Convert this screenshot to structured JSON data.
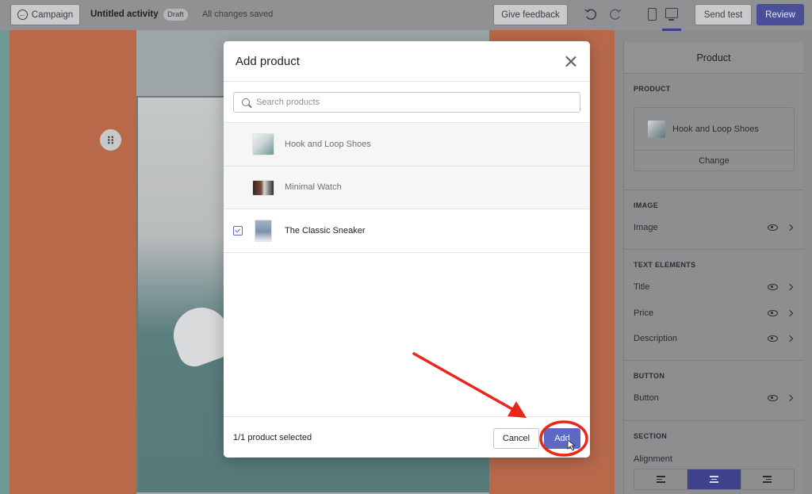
{
  "topbar": {
    "campaign_label": "Campaign",
    "activity_title": "Untitled activity",
    "status_badge": "Draft",
    "save_status": "All changes saved",
    "feedback_label": "Give feedback",
    "send_test_label": "Send test",
    "review_label": "Review"
  },
  "panel": {
    "title": "Product",
    "product_section": "PRODUCT",
    "selected_product": "Hook and Loop Shoes",
    "change_label": "Change",
    "image_section": "IMAGE",
    "image_row": "Image",
    "text_section": "TEXT ELEMENTS",
    "title_row": "Title",
    "price_row": "Price",
    "description_row": "Description",
    "button_section": "BUTTON",
    "button_row": "Button",
    "section_section": "SECTION",
    "alignment_label": "Alignment"
  },
  "modal": {
    "title": "Add product",
    "search_placeholder": "Search products",
    "products": [
      {
        "name": "Hook and Loop Shoes",
        "checked": false
      },
      {
        "name": "Minimal Watch",
        "checked": false
      },
      {
        "name": "The Classic Sneaker",
        "checked": true
      }
    ],
    "selected_count": "1/1 product selected",
    "cancel_label": "Cancel",
    "add_label": "Add"
  },
  "colors": {
    "primary": "#5c6ac4",
    "annotation": "#e8261c"
  }
}
